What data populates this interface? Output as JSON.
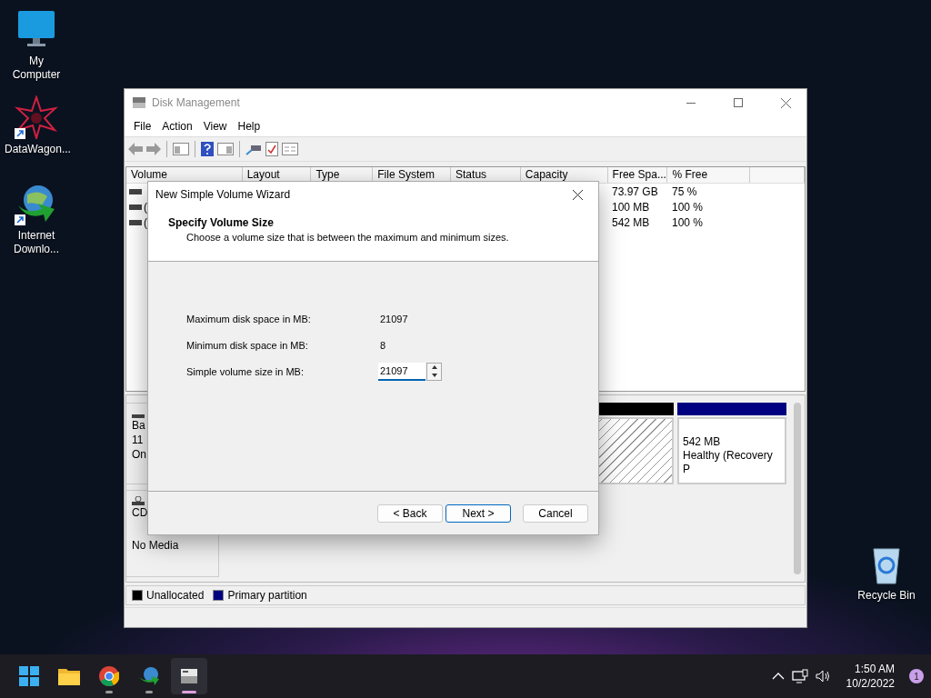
{
  "desktop_icons": [
    {
      "label": "My Computer",
      "kind": "computer"
    },
    {
      "label": "DataWagon...",
      "kind": "star",
      "shortcut": true
    },
    {
      "label": "Internet Downlo...",
      "kind": "globe",
      "shortcut": true
    },
    {
      "label": "Recycle Bin",
      "kind": "bin"
    }
  ],
  "window": {
    "title": "Disk Management",
    "menu": [
      "File",
      "Action",
      "View",
      "Help"
    ],
    "volume_list": {
      "columns": [
        "Volume",
        "Layout",
        "Type",
        "File System",
        "Status",
        "Capacity",
        "Free Spa...",
        "% Free"
      ],
      "rows": [
        {
          "free_space": "73.97 GB",
          "percent_free": "75 %"
        },
        {
          "volume": "(",
          "free_space": "100 MB",
          "percent_free": "100 %"
        },
        {
          "volume": "(",
          "free_space": "542 MB",
          "percent_free": "100 %"
        }
      ]
    },
    "disks": [
      {
        "kind": "basic",
        "label_lines": [
          "Ba",
          "11",
          "On"
        ],
        "partitions": [
          {
            "kind": "unallocated",
            "color": "#000000"
          },
          {
            "kind": "primary",
            "color": "#000080",
            "lines": [
              "542 MB",
              "Healthy (Recovery P"
            ]
          }
        ]
      },
      {
        "kind": "cdrom",
        "label_lines": [
          "CD"
        ],
        "status": "No Media"
      }
    ],
    "legend": [
      {
        "label": "Unallocated",
        "color": "#000000"
      },
      {
        "label": "Primary partition",
        "color": "#000080"
      }
    ]
  },
  "wizard": {
    "title": "New Simple Volume Wizard",
    "heading": "Specify Volume Size",
    "subtitle": "Choose a volume size that is between the maximum and minimum sizes.",
    "fields": [
      {
        "kind": "text",
        "label": "Maximum disk space in MB:",
        "value": "21097"
      },
      {
        "kind": "text",
        "label": "Minimum disk space in MB:",
        "value": "8"
      },
      {
        "kind": "spin",
        "label": "Simple volume size in MB:",
        "value": "21097"
      }
    ],
    "buttons": [
      {
        "label": "< Back",
        "default": false
      },
      {
        "label": "Next >",
        "default": true
      },
      {
        "label": "Cancel",
        "default": false
      }
    ]
  },
  "taskbar": {
    "apps": [
      {
        "kind": "start",
        "running": false,
        "selected": false
      },
      {
        "kind": "explorer",
        "running": false,
        "selected": false
      },
      {
        "kind": "chrome",
        "running": true,
        "selected": false
      },
      {
        "kind": "downloader",
        "running": true,
        "selected": false
      },
      {
        "kind": "disks",
        "running": true,
        "selected": true
      }
    ],
    "time": "1:50 AM",
    "date": "10/2/2022",
    "notifications": "1"
  }
}
